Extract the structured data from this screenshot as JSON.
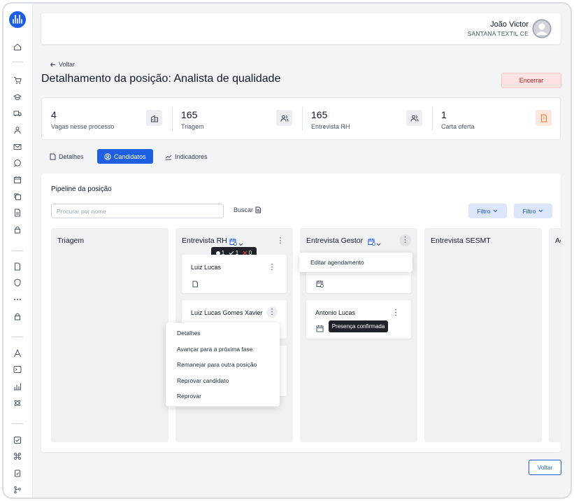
{
  "user": {
    "name": "João Victor",
    "company": "SANTANA TEXTIL CE"
  },
  "nav": {
    "back_label": "Voltar"
  },
  "page": {
    "title": "Detalhamento da posição: Analista de qualidade",
    "close_button": "Encerrar"
  },
  "stats": [
    {
      "value": "4",
      "label": "Vagas nesse processo",
      "icon": "building-icon"
    },
    {
      "value": "165",
      "label": "Triagem",
      "icon": "users-icon"
    },
    {
      "value": "165",
      "label": "Entrevista RH",
      "icon": "users-icon"
    },
    {
      "value": "1",
      "label": "Carta oferta",
      "icon": "document-icon"
    }
  ],
  "tabs": [
    {
      "label": "Detalhes"
    },
    {
      "label": "Candidatos",
      "active": true
    },
    {
      "label": "Indicadores"
    }
  ],
  "pipeline": {
    "title": "Pipeline da posição",
    "search_placeholder": "Procurar por nome",
    "search_button": "Buscar",
    "filter_1": "Filtro",
    "filter_2": "Filtro",
    "columns": [
      {
        "title": "Triagem"
      },
      {
        "title": "Entrevista RH",
        "stats": {
          "pending": "1",
          "confirmed": "1",
          "rejected": "0"
        }
      },
      {
        "title": "Entrevista Gestor"
      },
      {
        "title": "Entrevista SESMT"
      },
      {
        "title": "Ad"
      }
    ],
    "cards": {
      "rh_1": "Luiz Lucas",
      "rh_2": "Luiz Lucas Gomes Xavier",
      "gestor_2": "Antonio Lucas"
    },
    "tooltip_presence": "Presença confirmada",
    "gestor_menu": [
      "Editar agendamento"
    ],
    "candidate_menu": [
      "Detalhes",
      "Avançar para a próxima fase",
      "Remanejar para outra posição",
      "Reprovar candidato",
      "Reprovar"
    ]
  },
  "footer": {
    "back_button": "Voltar"
  },
  "colors": {
    "primary": "#1d5fe0",
    "danger_bg": "#fde2e2",
    "danger_text": "#b91c1c"
  }
}
